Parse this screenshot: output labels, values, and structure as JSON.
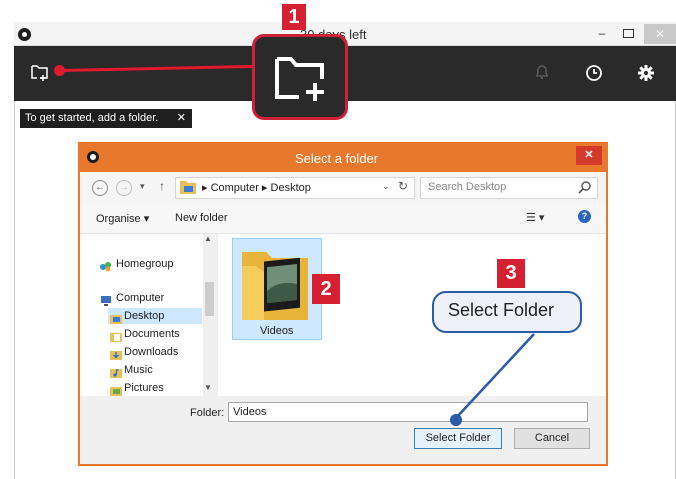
{
  "app": {
    "title": "30 days left",
    "minimize": "–",
    "close": "✕",
    "tooltip": "To get started, add a folder.",
    "tooltip_close": "✕"
  },
  "badges": {
    "one": "1",
    "two": "2",
    "three": "3"
  },
  "dialog": {
    "title": "Select a folder",
    "close": "✕",
    "nav": {
      "back": "←",
      "forward": "→",
      "recent": "▾",
      "up": "↑",
      "address": "▸ Computer ▸ Desktop",
      "address_dropdown": "⌄",
      "refresh": "↻"
    },
    "search_placeholder": "Search Desktop",
    "commands": {
      "organise": "Organise ▾",
      "new_folder": "New folder",
      "view": "☰ ▾",
      "help": "?"
    },
    "nav_tree": {
      "homegroup": "Homegroup",
      "computer": "Computer",
      "desktop": "Desktop",
      "documents": "Documents",
      "downloads": "Downloads",
      "music": "Music",
      "pictures": "Pictures",
      "scroll_up": "▲",
      "scroll_down": "▼"
    },
    "files": [
      {
        "name": "Videos"
      }
    ],
    "footer": {
      "folder_label": "Folder:",
      "folder_value": "Videos",
      "select_button": "Select Folder",
      "cancel_button": "Cancel"
    }
  },
  "callout": {
    "select_folder": "Select Folder"
  },
  "colors": {
    "accent_red": "#d42031",
    "dialog_orange": "#e8792c",
    "callout_blue": "#2b5aa6",
    "toolbar_dark": "#2a2a2a",
    "selection_blue": "#cde8ff"
  },
  "icons": [
    "add-folder-icon",
    "bell-icon",
    "history-icon",
    "gear-icon",
    "search-icon",
    "folder-icon",
    "help-icon"
  ]
}
